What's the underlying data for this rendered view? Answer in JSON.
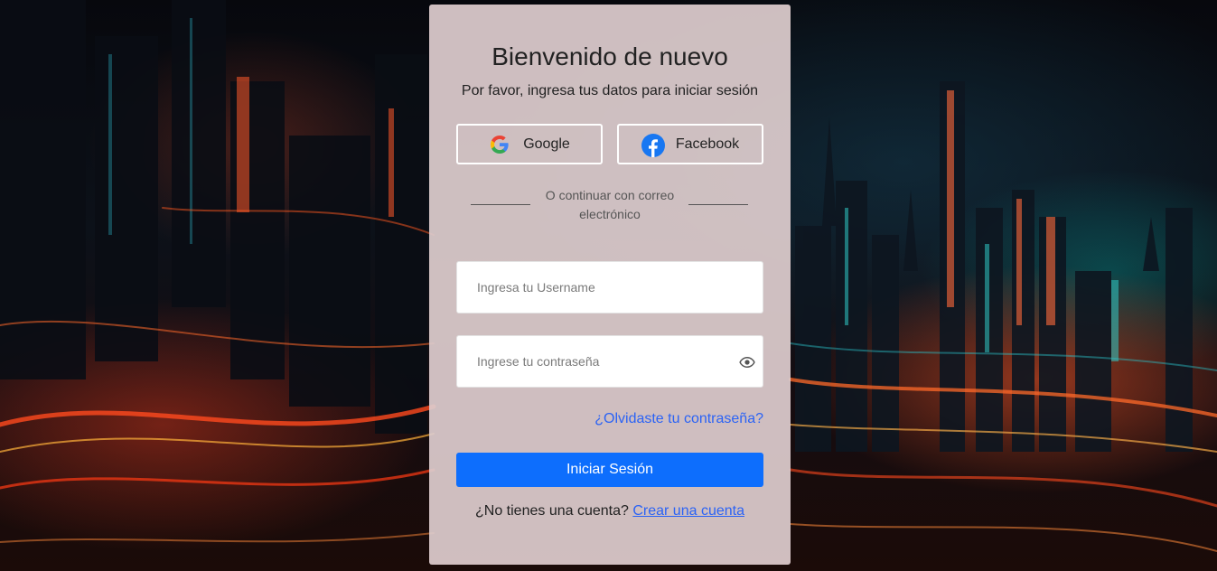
{
  "login": {
    "title": "Bienvenido de nuevo",
    "subtitle": "Por favor, ingresa tus datos para iniciar sesión",
    "social": {
      "google_label": "Google",
      "facebook_label": "Facebook"
    },
    "divider_text": "O continuar con correo electrónico",
    "username": {
      "placeholder": "Ingresa tu Username",
      "value": ""
    },
    "password": {
      "placeholder": "Ingrese tu contraseña",
      "value": ""
    },
    "forgot_link": "¿Olvidaste tu contraseña?",
    "submit_label": "Iniciar Sesión",
    "signup_prompt": "¿No tienes una cuenta?",
    "signup_link": "Crear una cuenta"
  },
  "icons": {
    "google": "google-icon",
    "facebook": "facebook-icon",
    "eye": "eye-icon"
  },
  "colors": {
    "primary_button": "#0d6efd",
    "link": "#2b63f5",
    "card_background": "#decccd",
    "facebook_blue": "#1877f2"
  }
}
